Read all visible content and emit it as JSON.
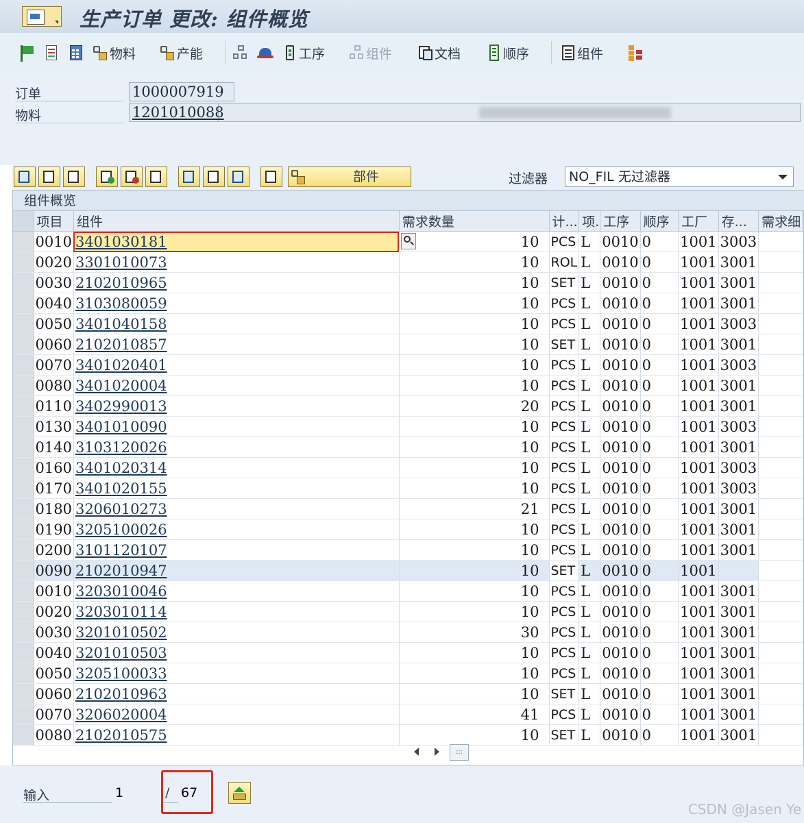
{
  "window": {
    "title": "生产订单 更改: 组件概览"
  },
  "toolbar": {
    "material_label": "物料",
    "capacity_label": "产能",
    "operation_label": "工序",
    "component_label_disabled": "组件",
    "documents_label": "文档",
    "sequence_label": "顺序",
    "component_label": "组件"
  },
  "header": {
    "order_label": "订单",
    "order_value": "1000007919",
    "material_label": "物料",
    "material_value": "1201010088"
  },
  "grid_toolbar": {
    "parts_button_label": "部件",
    "filter_label": "过滤器",
    "filter_value": "NO_FIL 无过滤器"
  },
  "panel": {
    "title": "组件概览",
    "columns": [
      "项目",
      "组件",
      "需求数量",
      "计...",
      "项.",
      "工序",
      "顺序",
      "工厂",
      "存...",
      "需求细"
    ],
    "rows": [
      {
        "item": "0010",
        "component": "3401030181",
        "qty": "10",
        "unit": "PCS",
        "cat": "L",
        "op": "0010",
        "seq": "0",
        "plant": "1001",
        "sloc": "3003"
      },
      {
        "item": "0020",
        "component": "3301010073",
        "qty": "10",
        "unit": "ROL",
        "cat": "L",
        "op": "0010",
        "seq": "0",
        "plant": "1001",
        "sloc": "3001"
      },
      {
        "item": "0030",
        "component": "2102010965",
        "qty": "10",
        "unit": "SET",
        "cat": "L",
        "op": "0010",
        "seq": "0",
        "plant": "1001",
        "sloc": "3001"
      },
      {
        "item": "0040",
        "component": "3103080059",
        "qty": "10",
        "unit": "PCS",
        "cat": "L",
        "op": "0010",
        "seq": "0",
        "plant": "1001",
        "sloc": "3001"
      },
      {
        "item": "0050",
        "component": "3401040158",
        "qty": "10",
        "unit": "PCS",
        "cat": "L",
        "op": "0010",
        "seq": "0",
        "plant": "1001",
        "sloc": "3003"
      },
      {
        "item": "0060",
        "component": "2102010857",
        "qty": "10",
        "unit": "SET",
        "cat": "L",
        "op": "0010",
        "seq": "0",
        "plant": "1001",
        "sloc": "3001"
      },
      {
        "item": "0070",
        "component": "3401020401",
        "qty": "10",
        "unit": "PCS",
        "cat": "L",
        "op": "0010",
        "seq": "0",
        "plant": "1001",
        "sloc": "3003"
      },
      {
        "item": "0080",
        "component": "3401020004",
        "qty": "10",
        "unit": "PCS",
        "cat": "L",
        "op": "0010",
        "seq": "0",
        "plant": "1001",
        "sloc": "3001"
      },
      {
        "item": "0110",
        "component": "3402990013",
        "qty": "20",
        "unit": "PCS",
        "cat": "L",
        "op": "0010",
        "seq": "0",
        "plant": "1001",
        "sloc": "3001"
      },
      {
        "item": "0130",
        "component": "3401010090",
        "qty": "10",
        "unit": "PCS",
        "cat": "L",
        "op": "0010",
        "seq": "0",
        "plant": "1001",
        "sloc": "3003"
      },
      {
        "item": "0140",
        "component": "3103120026",
        "qty": "10",
        "unit": "PCS",
        "cat": "L",
        "op": "0010",
        "seq": "0",
        "plant": "1001",
        "sloc": "3001"
      },
      {
        "item": "0160",
        "component": "3401020314",
        "qty": "10",
        "unit": "PCS",
        "cat": "L",
        "op": "0010",
        "seq": "0",
        "plant": "1001",
        "sloc": "3003"
      },
      {
        "item": "0170",
        "component": "3401020155",
        "qty": "10",
        "unit": "PCS",
        "cat": "L",
        "op": "0010",
        "seq": "0",
        "plant": "1001",
        "sloc": "3003"
      },
      {
        "item": "0180",
        "component": "3206010273",
        "qty": "21",
        "unit": "PCS",
        "cat": "L",
        "op": "0010",
        "seq": "0",
        "plant": "1001",
        "sloc": "3001"
      },
      {
        "item": "0190",
        "component": "3205100026",
        "qty": "10",
        "unit": "PCS",
        "cat": "L",
        "op": "0010",
        "seq": "0",
        "plant": "1001",
        "sloc": "3001"
      },
      {
        "item": "0200",
        "component": "3101120107",
        "qty": "10",
        "unit": "PCS",
        "cat": "L",
        "op": "0010",
        "seq": "0",
        "plant": "1001",
        "sloc": "3001"
      },
      {
        "item": "0090",
        "component": "2102010947",
        "qty": "10",
        "unit": "SET",
        "cat": "L",
        "op": "0010",
        "seq": "0",
        "plant": "1001",
        "sloc": ""
      },
      {
        "item": "0010",
        "component": "3203010046",
        "qty": "10",
        "unit": "PCS",
        "cat": "L",
        "op": "0010",
        "seq": "0",
        "plant": "1001",
        "sloc": "3001"
      },
      {
        "item": "0020",
        "component": "3203010114",
        "qty": "10",
        "unit": "PCS",
        "cat": "L",
        "op": "0010",
        "seq": "0",
        "plant": "1001",
        "sloc": "3001"
      },
      {
        "item": "0030",
        "component": "3201010502",
        "qty": "30",
        "unit": "PCS",
        "cat": "L",
        "op": "0010",
        "seq": "0",
        "plant": "1001",
        "sloc": "3001"
      },
      {
        "item": "0040",
        "component": "3201010503",
        "qty": "10",
        "unit": "PCS",
        "cat": "L",
        "op": "0010",
        "seq": "0",
        "plant": "1001",
        "sloc": "3001"
      },
      {
        "item": "0050",
        "component": "3205100033",
        "qty": "10",
        "unit": "PCS",
        "cat": "L",
        "op": "0010",
        "seq": "0",
        "plant": "1001",
        "sloc": "3001"
      },
      {
        "item": "0060",
        "component": "2102010963",
        "qty": "10",
        "unit": "SET",
        "cat": "L",
        "op": "0010",
        "seq": "0",
        "plant": "1001",
        "sloc": "3001"
      },
      {
        "item": "0070",
        "component": "3206020004",
        "qty": "41",
        "unit": "PCS",
        "cat": "L",
        "op": "0010",
        "seq": "0",
        "plant": "1001",
        "sloc": "3001"
      },
      {
        "item": "0080",
        "component": "2102010575",
        "qty": "10",
        "unit": "SET",
        "cat": "L",
        "op": "0010",
        "seq": "0",
        "plant": "1001",
        "sloc": "3001"
      }
    ]
  },
  "footer": {
    "input_label": "输入",
    "input_value": "1",
    "slash": "/",
    "total": "67"
  },
  "watermark": "CSDN @Jasen Ye"
}
